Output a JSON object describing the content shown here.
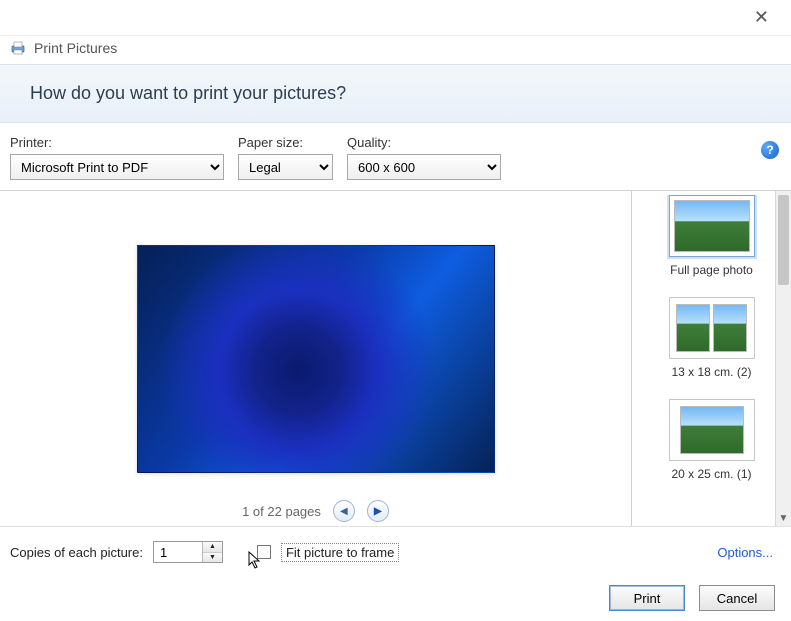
{
  "window": {
    "title": "Print Pictures"
  },
  "header": {
    "question": "How do you want to print your pictures?"
  },
  "controls": {
    "printer_label": "Printer:",
    "printer_value": "Microsoft Print to PDF",
    "paper_label": "Paper size:",
    "paper_value": "Legal",
    "quality_label": "Quality:",
    "quality_value": "600 x 600"
  },
  "pager": {
    "text": "1 of 22 pages"
  },
  "layouts": [
    {
      "label": "Full page photo"
    },
    {
      "label": "13 x 18 cm. (2)"
    },
    {
      "label": "20 x 25 cm. (1)"
    }
  ],
  "copies": {
    "label": "Copies of each picture:",
    "value": "1",
    "fit_label": "Fit picture to frame",
    "options_link": "Options..."
  },
  "buttons": {
    "print": "Print",
    "cancel": "Cancel"
  },
  "help_glyph": "?"
}
